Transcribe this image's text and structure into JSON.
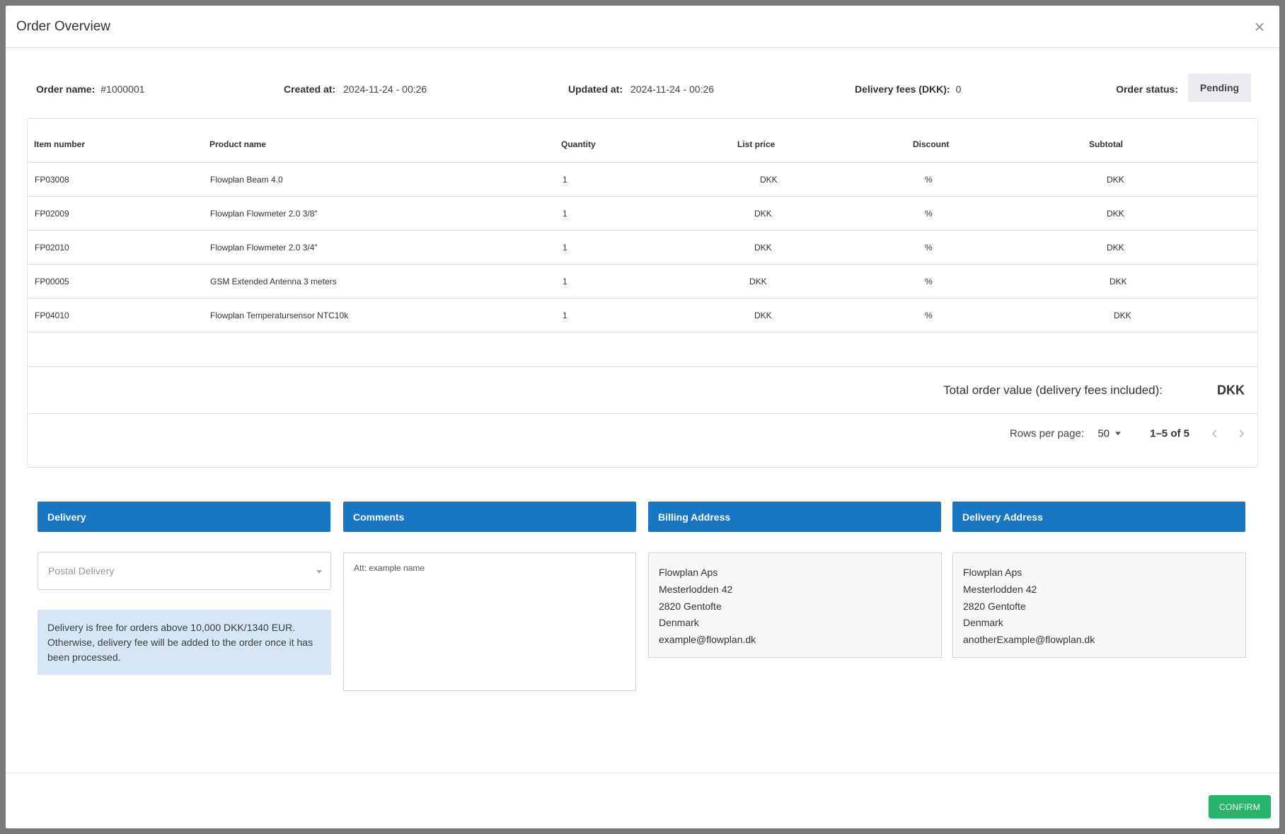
{
  "modal": {
    "title": "Order Overview"
  },
  "summary": {
    "order_name_label": "Order name:",
    "order_name_value": "#1000001",
    "created_label": "Created at:",
    "created_value": "2024-11-24 - 00:26",
    "updated_label": "Updated at:",
    "updated_value": "2024-11-24 - 00:26",
    "fees_label": "Delivery fees (DKK):",
    "fees_value": "0",
    "status_label": "Order status:",
    "status_value": "Pending"
  },
  "table": {
    "headers": [
      "Item number",
      "Product name",
      "Quantity",
      "List price",
      "Discount",
      "Subtotal"
    ],
    "rows": [
      {
        "item": "FP03008",
        "product": "Flowplan Beam 4.0",
        "qty": "1",
        "price": "DKK",
        "discount": "%",
        "subtotal": "DKK"
      },
      {
        "item": "FP02009",
        "product": "Flowplan Flowmeter 2.0 3/8\"",
        "qty": "1",
        "price": "DKK",
        "discount": "%",
        "subtotal": "DKK"
      },
      {
        "item": "FP02010",
        "product": "Flowplan Flowmeter 2.0 3/4\"",
        "qty": "1",
        "price": "DKK",
        "discount": "%",
        "subtotal": "DKK"
      },
      {
        "item": "FP00005",
        "product": "GSM Extended Antenna 3 meters",
        "qty": "1",
        "price": "DKK",
        "discount": "%",
        "subtotal": "DKK"
      },
      {
        "item": "FP04010",
        "product": "Flowplan Temperatursensor NTC10k",
        "qty": "1",
        "price": "DKK",
        "discount": "%",
        "subtotal": "DKK"
      }
    ],
    "total_label": "Total order value (delivery fees included):",
    "total_value": "DKK",
    "rows_per_page_label": "Rows per page:",
    "rows_per_page_value": "50",
    "range_text": "1–5 of 5"
  },
  "sections": {
    "delivery": "Delivery",
    "comments": "Comments",
    "billing": "Billing Address",
    "delivery_address": "Delivery Address"
  },
  "delivery": {
    "select_placeholder": "Postal Delivery",
    "info_text": "Delivery is free for orders above 10,000 DKK/1340 EUR. Otherwise, delivery fee will be added to the order once it has been processed."
  },
  "comments": {
    "value": "Att: example name"
  },
  "billing_address": {
    "lines": [
      "Flowplan Aps",
      "Mesterlodden 42",
      "2820 Gentofte",
      "Denmark",
      "example@flowplan.dk"
    ]
  },
  "delivery_address": {
    "lines": [
      "Flowplan Aps",
      "Mesterlodden 42",
      "2820 Gentofte",
      "Denmark",
      "anotherExample@flowplan.dk"
    ]
  },
  "footer": {
    "confirm_label": "CONFIRM"
  },
  "colors": {
    "section_header": "#1876c2",
    "info_box": "#d6e6f4",
    "confirm": "#27b36b",
    "status_badge": "#ebebf2"
  }
}
